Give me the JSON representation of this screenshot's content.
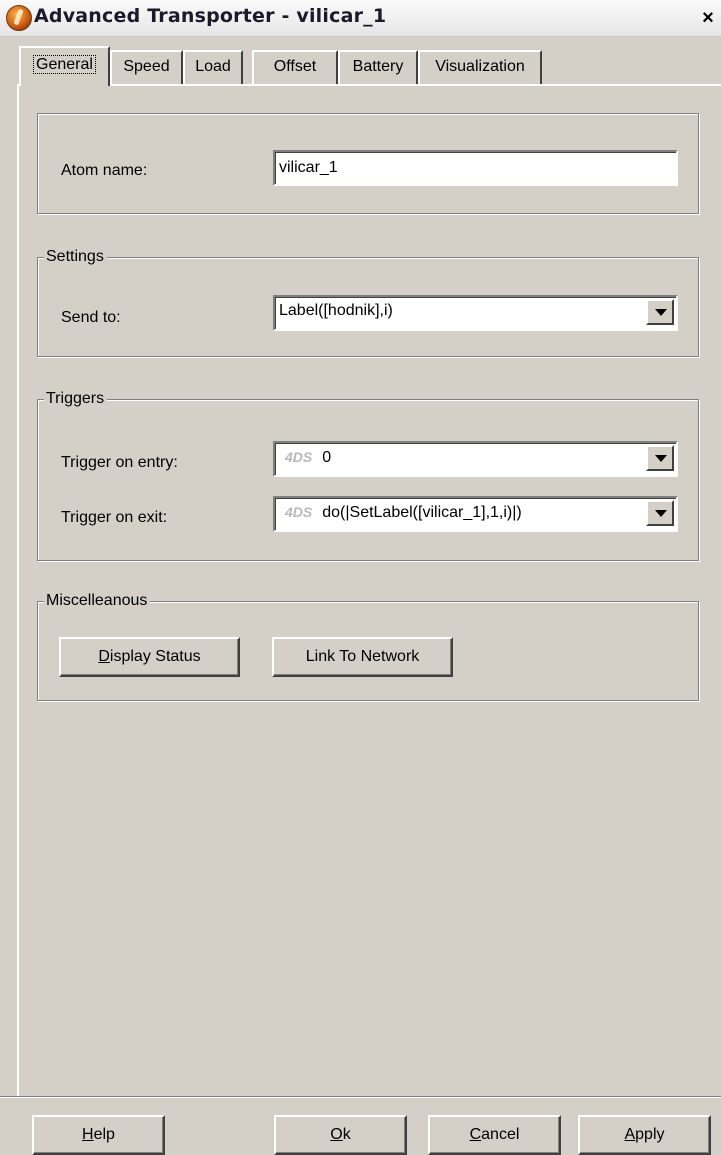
{
  "window": {
    "title": "Advanced Transporter - vilicar_1",
    "close_glyph": "×"
  },
  "tabs": [
    {
      "label": "General",
      "active": true
    },
    {
      "label": "Speed"
    },
    {
      "label": "Load"
    },
    {
      "label": "Offset"
    },
    {
      "label": "Battery"
    },
    {
      "label": "Visualization"
    }
  ],
  "general": {
    "atom_name_label": "Atom name:",
    "atom_name_value": "vilicar_1"
  },
  "settings": {
    "legend": "Settings",
    "send_to_label": "Send to:",
    "send_to_value": "Label([hodnik],i)"
  },
  "triggers": {
    "legend": "Triggers",
    "code_tag": "4DS",
    "entry_label": "Trigger on entry:",
    "entry_value": "0",
    "exit_label": "Trigger on exit:",
    "exit_value": "do(|SetLabel([vilicar_1],1,i)|)"
  },
  "misc": {
    "legend": "Miscelleanous",
    "display_status": {
      "pre": "",
      "mnemonic": "D",
      "post": "isplay Status"
    },
    "link_to_network": "Link To Network"
  },
  "footer": {
    "help": {
      "pre": "",
      "mnemonic": "H",
      "post": "elp"
    },
    "ok": {
      "pre": "",
      "mnemonic": "O",
      "post": "k"
    },
    "cancel": {
      "pre": "",
      "mnemonic": "C",
      "post": "ancel"
    },
    "apply": {
      "pre": "",
      "mnemonic": "A",
      "post": "pply"
    }
  },
  "icons": {
    "app_icon": "app-logo-icon",
    "dropdown": "chevron-down-icon",
    "close": "close-icon"
  }
}
